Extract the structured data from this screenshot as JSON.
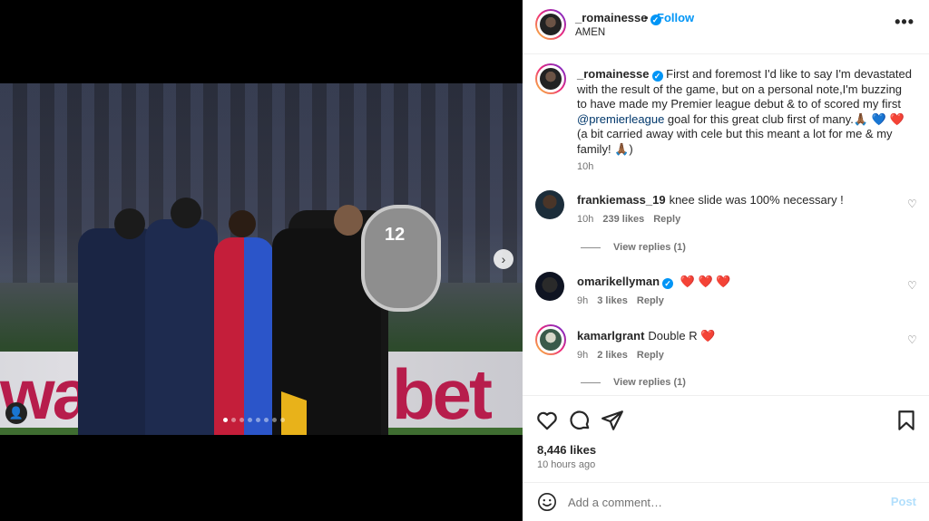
{
  "post": {
    "author": "_romainesse",
    "author_subtitle": "AMEN",
    "follow_label": "Follow",
    "follow_sep": "•",
    "more_label": "•••",
    "media": {
      "board_text_left": "wa",
      "board_text_right": "bet",
      "sign_text": "12",
      "carousel_index": 0,
      "carousel_count": 8,
      "next_glyph": "›",
      "tag_glyph": "👤"
    }
  },
  "caption": {
    "username": "_romainesse",
    "text_before_mention": "First and foremost I'd like to say I'm devastated with the result of the game, but on a personal note,I'm buzzing to have made my Premier league debut & to of scored my first ",
    "mention": "@premierleague",
    "text_after_mention": " goal for this great club first of many.🙏🏾 💙 ❤️ (a bit carried away with cele but this meant a lot for me & my family! 🙏🏾)",
    "time": "10h"
  },
  "comments": [
    {
      "username": "frankiemass_19",
      "verified": false,
      "text": "knee slide was 100% necessary !",
      "time": "10h",
      "likes": "239 likes",
      "reply_label": "Reply",
      "view_replies": "View replies (1)"
    },
    {
      "username": "omarikellyman",
      "verified": true,
      "text": "❤️ ❤️ ❤️",
      "time": "9h",
      "likes": "3 likes",
      "reply_label": "Reply",
      "view_replies": ""
    },
    {
      "username": "kamarlgrant",
      "verified": false,
      "text": "Double R ❤️",
      "time": "9h",
      "likes": "2 likes",
      "reply_label": "Reply",
      "view_replies": "View replies (1)"
    }
  ],
  "actions": {
    "likes": "8,446 likes",
    "ago": "10 hours ago"
  },
  "add_comment": {
    "placeholder": "Add a comment…",
    "post_label": "Post"
  },
  "colors": {
    "accent": "#0095f6",
    "heart": "#ed4956",
    "muted": "#737373",
    "post_disabled": "#b2dffc"
  }
}
